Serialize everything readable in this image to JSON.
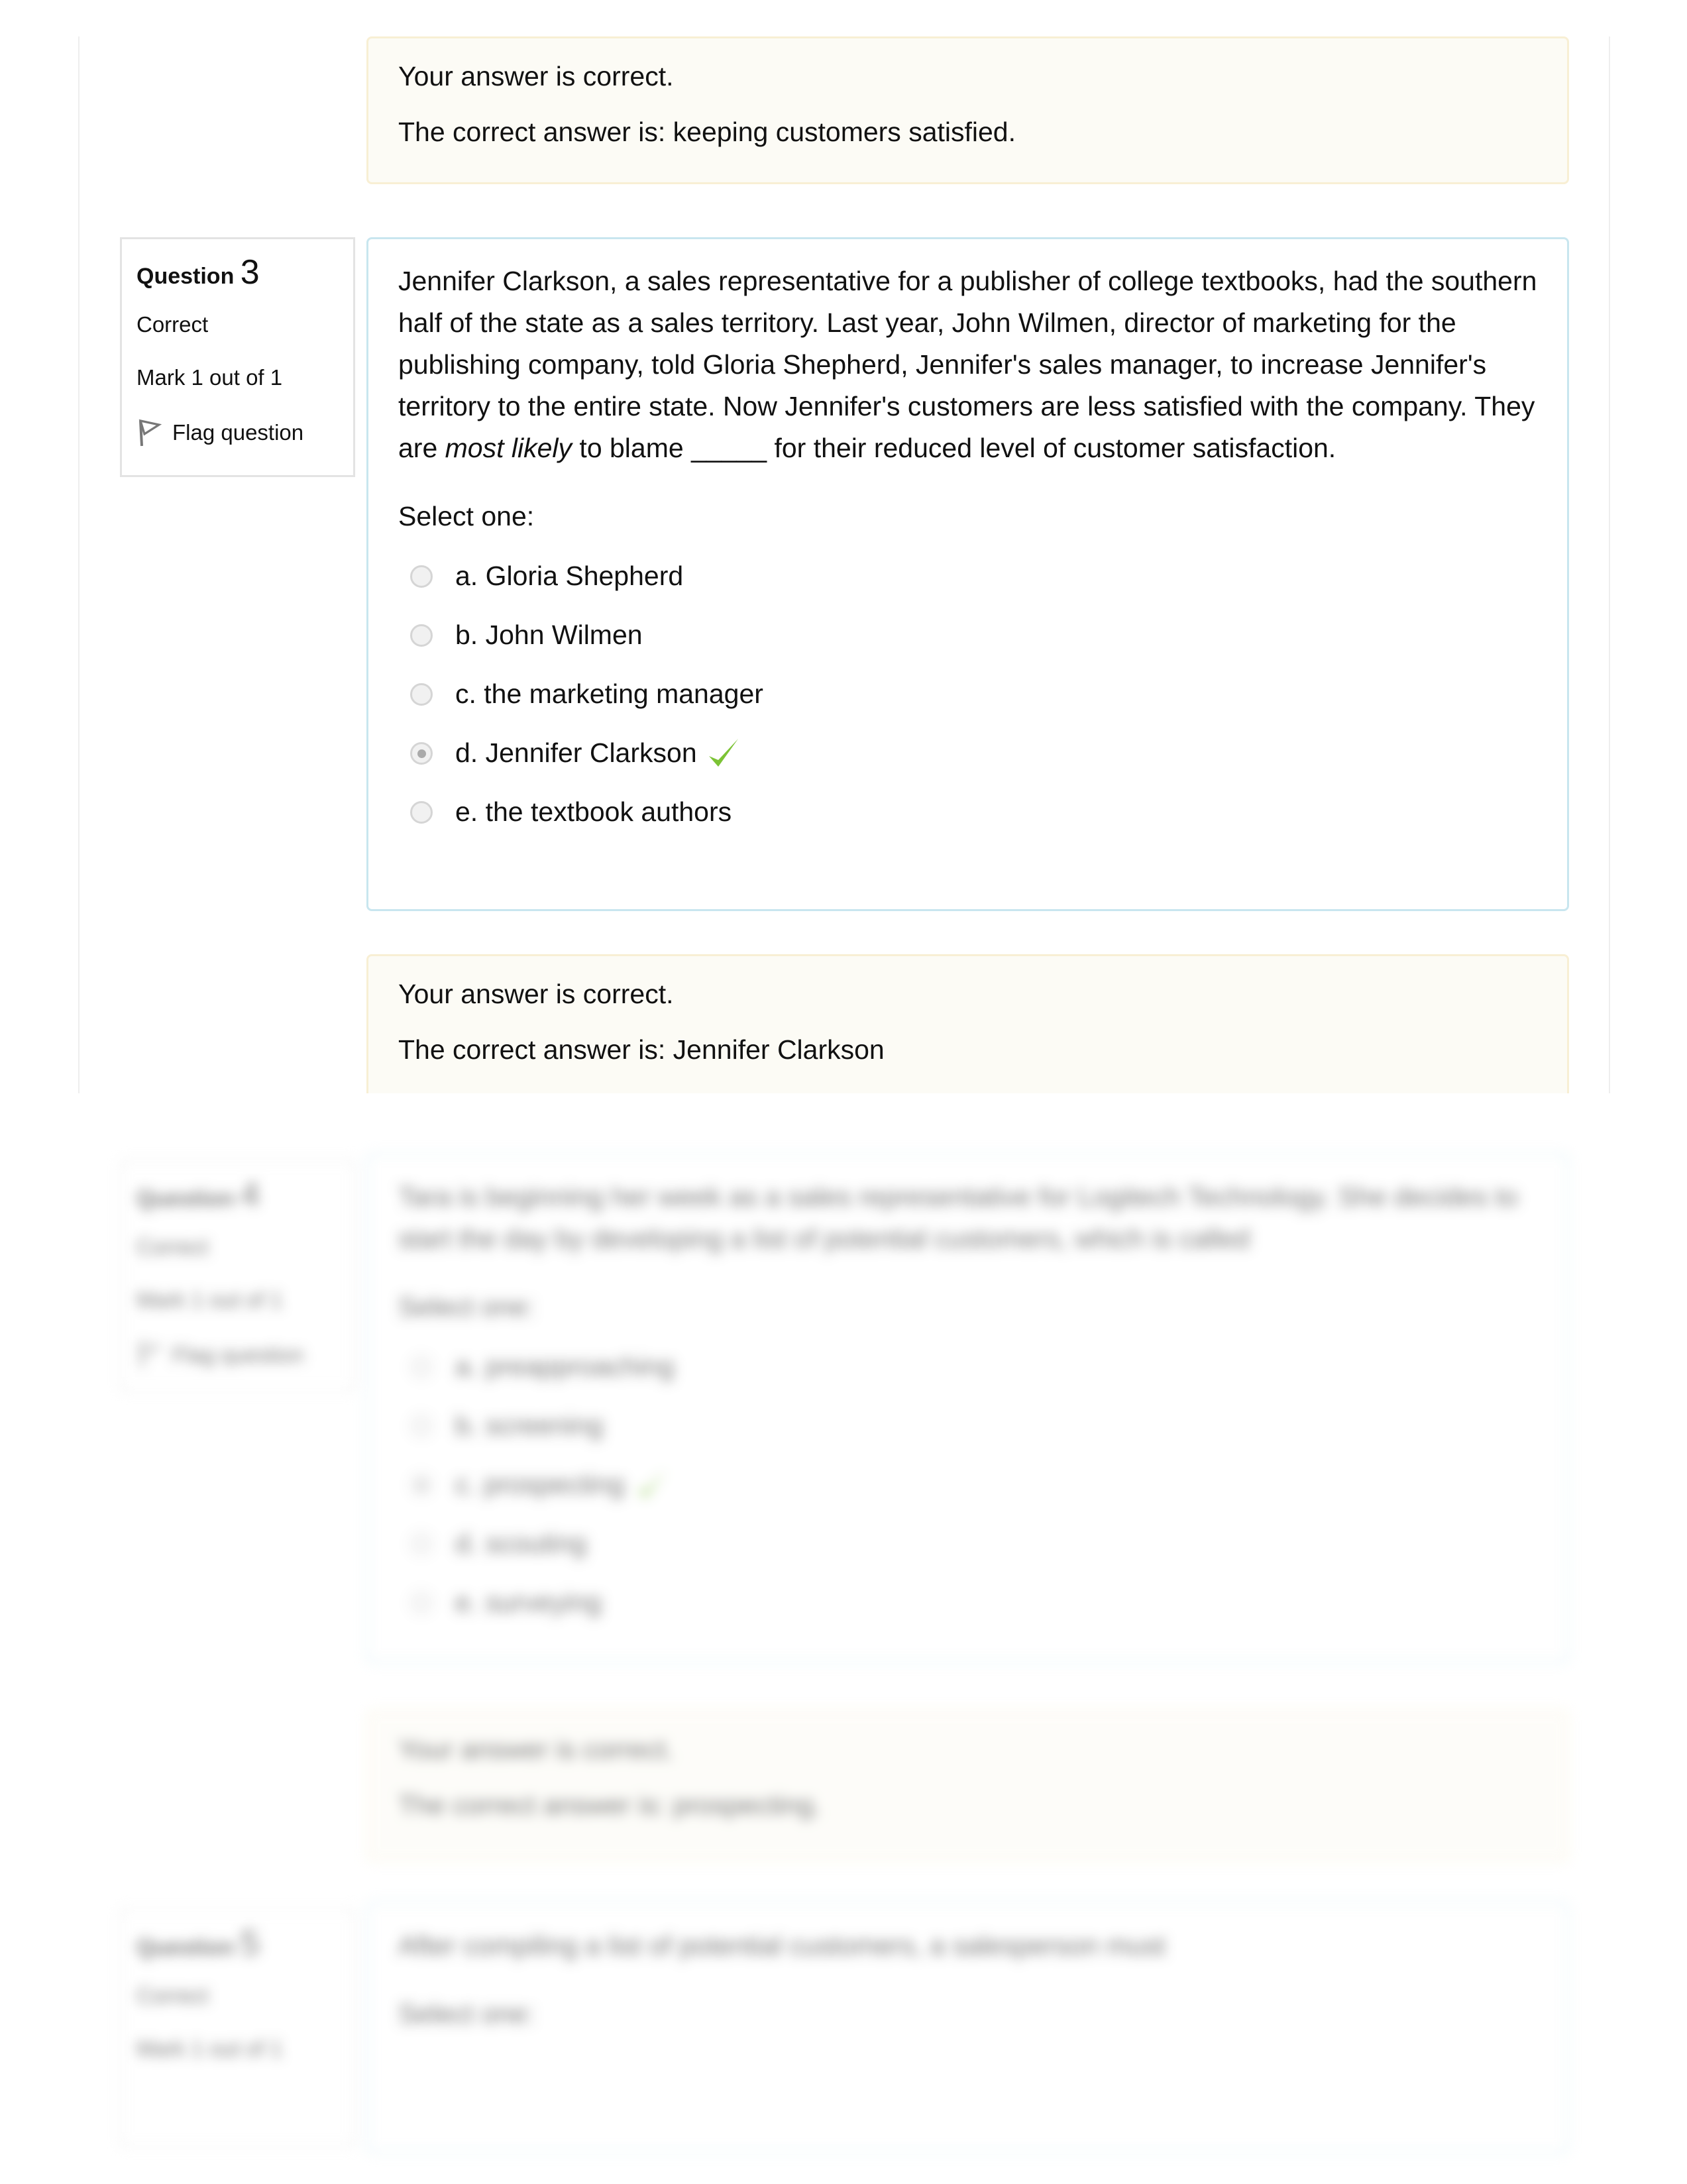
{
  "q2_feedback": {
    "status": "Your answer is correct.",
    "correct_answer": "The correct answer is: keeping customers satisfied."
  },
  "q3": {
    "info": {
      "label": "Question",
      "number": "3",
      "state": "Correct",
      "mark": "Mark 1 out of 1",
      "flag": "Flag question"
    },
    "text_before": "Jennifer Clarkson, a sales representative for a publisher of college textbooks, had the southern half of the state as a sales territory. Last year, John Wilmen, director of marketing for the publishing company, told Gloria Shepherd, Jennifer's sales manager, to increase Jennifer's territory to the entire state. Now Jennifer's customers are less satisfied with the company. They are ",
    "text_emph": "most likely",
    "text_after": " to blame _____ for their reduced level of customer satisfaction.",
    "select_label": "Select one:",
    "options": [
      {
        "label": "a. Gloria Shepherd",
        "selected": false
      },
      {
        "label": "b. John Wilmen",
        "selected": false
      },
      {
        "label": "c. the marketing manager",
        "selected": false
      },
      {
        "label": "d. Jennifer Clarkson",
        "selected": true,
        "correct": true
      },
      {
        "label": "e. the textbook authors",
        "selected": false
      }
    ],
    "feedback": {
      "status": "Your answer is correct.",
      "correct_answer": "The correct answer is: Jennifer Clarkson"
    }
  },
  "q4": {
    "info": {
      "label": "Question",
      "number": "4",
      "state": "Correct",
      "mark": "Mark 1 out of 1",
      "flag": "Flag question"
    },
    "text": "Tara is beginning her week as a sales representative for Logitech Technology. She decides to start the day by developing a list of potential customers, which is called",
    "select_label": "Select one:",
    "options": [
      {
        "label": "a. preapproaching",
        "selected": false
      },
      {
        "label": "b. screening",
        "selected": false
      },
      {
        "label": "c. prospecting",
        "selected": true,
        "correct": true
      },
      {
        "label": "d. scouting",
        "selected": false
      },
      {
        "label": "e. surveying",
        "selected": false
      }
    ],
    "feedback": {
      "status": "Your answer is correct.",
      "correct_answer": "The correct answer is: prospecting."
    }
  },
  "q5": {
    "info": {
      "label": "Question",
      "number": "5",
      "state": "Correct",
      "mark": "Mark 1 out of 1"
    },
    "text": "After compiling a list of potential customers, a salesperson must",
    "select_label": "Select one:"
  },
  "colors": {
    "check": "#7cc335",
    "question_border": "#c8e6ef",
    "feedback_border": "#f8efd4",
    "feedback_bg": "#fcfbf5"
  }
}
